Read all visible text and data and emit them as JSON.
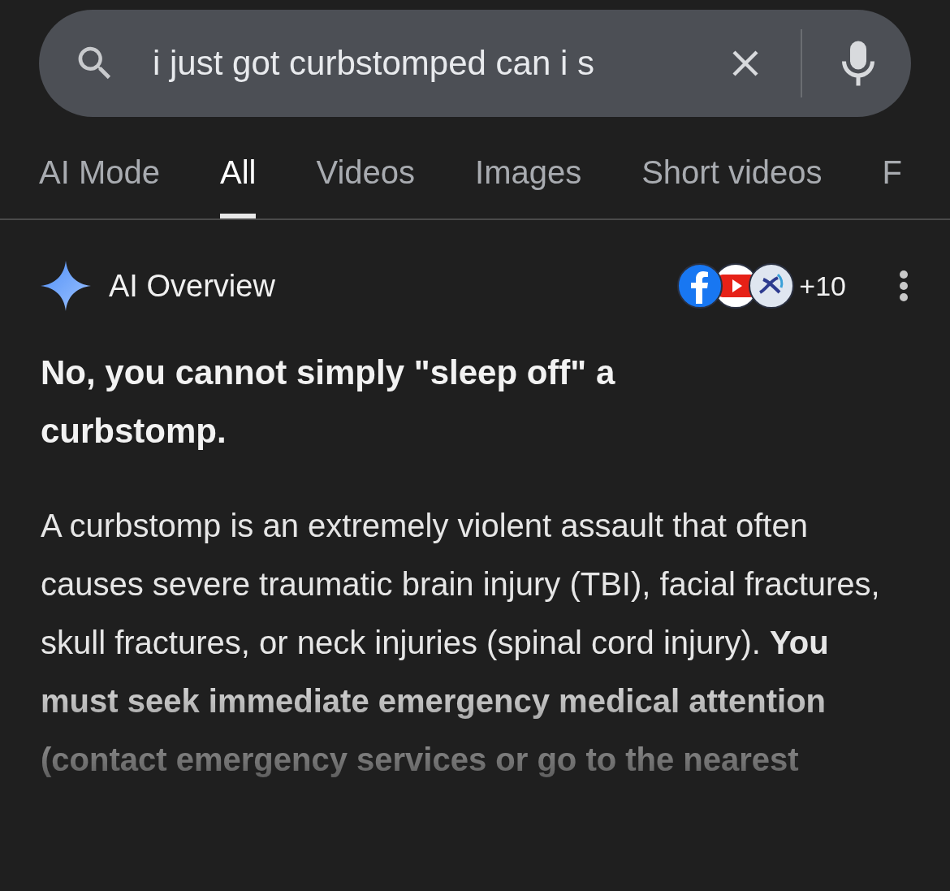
{
  "search": {
    "value": "i just got curbstomped can i s"
  },
  "tabs": [
    {
      "label": "AI Mode",
      "selected": false
    },
    {
      "label": "All",
      "selected": true
    },
    {
      "label": "Videos",
      "selected": false
    },
    {
      "label": "Images",
      "selected": false
    },
    {
      "label": "Short videos",
      "selected": false
    },
    {
      "label": "F",
      "selected": false
    }
  ],
  "overview": {
    "title": "AI Overview",
    "sources": [
      {
        "kind": "facebook"
      },
      {
        "kind": "youtube"
      },
      {
        "kind": "site"
      }
    ],
    "more_sources": "+10",
    "headline": "No, you cannot simply \"sleep off\" a curbstomp.",
    "paragraph": "A curbstomp is an extremely violent assault that often causes severe traumatic brain injury (TBI), facial fractures, skull fractures, or neck injuries (spinal cord injury). **You must seek immediate emergency medical attention (contact emergency services or go to the nearest**"
  }
}
